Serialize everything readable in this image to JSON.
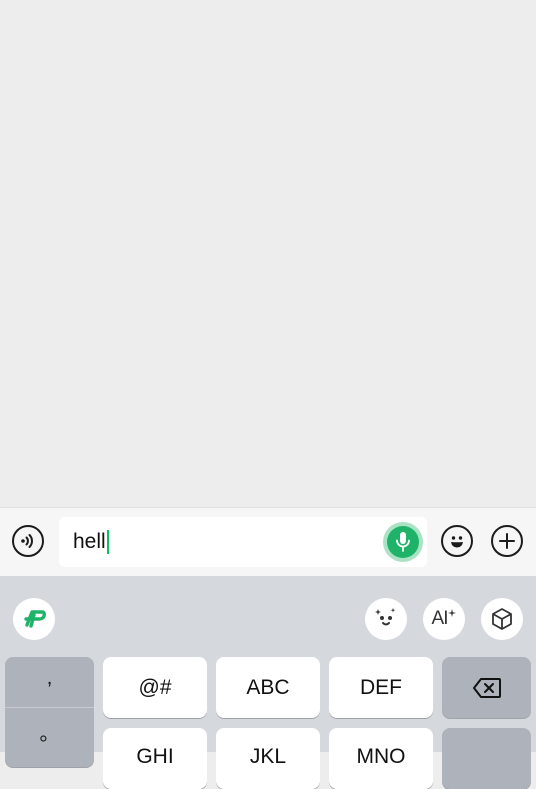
{
  "input": {
    "value": "hell"
  },
  "keyboard": {
    "punctuation": [
      ",",
      "。"
    ],
    "row1": [
      "@#",
      "ABC",
      "DEF"
    ],
    "row2": [
      "GHI",
      "JKL",
      "MNO"
    ],
    "toolbar": {
      "ai_label": "AI"
    }
  },
  "colors": {
    "accent": "#07c160",
    "mic": "#1fb36a",
    "background": "#ededed"
  },
  "icons": {
    "voice": "voice-wave-icon",
    "mic": "mic-icon",
    "emoji": "smiley-icon",
    "plus": "plus-icon",
    "logo": "keyboard-logo-icon",
    "smart": "smart-face-icon",
    "ai": "ai-sparkle-icon",
    "box": "cube-icon",
    "backspace": "backspace-icon"
  }
}
